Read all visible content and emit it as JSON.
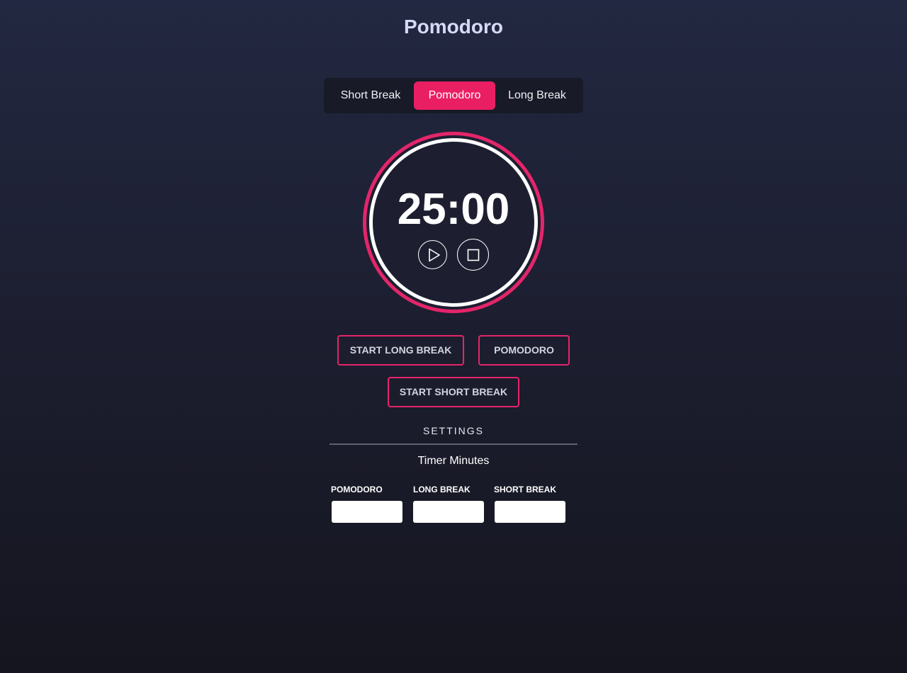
{
  "app": {
    "title": "Pomodoro"
  },
  "mode_tabs": [
    {
      "label": "Short Break",
      "active": false
    },
    {
      "label": "Pomodoro",
      "active": true
    },
    {
      "label": "Long Break",
      "active": false
    }
  ],
  "timer": {
    "display": "25:00",
    "play_icon": "play-icon",
    "stop_icon": "stop-icon"
  },
  "actions": {
    "start_long_break": "START LONG BREAK",
    "pomodoro": "POMODORO",
    "start_short_break": "START SHORT BREAK"
  },
  "settings": {
    "heading": "SETTINGS",
    "subheading": "Timer Minutes",
    "fields": [
      {
        "label": "POMODORO",
        "value": ""
      },
      {
        "label": "LONG BREAK",
        "value": ""
      },
      {
        "label": "SHORT BREAK",
        "value": ""
      }
    ]
  },
  "colors": {
    "accent": "#ea1f63",
    "ring_outer": "#e4256a",
    "ring_inner": "#ffffff",
    "background_top": "#222841",
    "background_bottom": "#15151f"
  }
}
